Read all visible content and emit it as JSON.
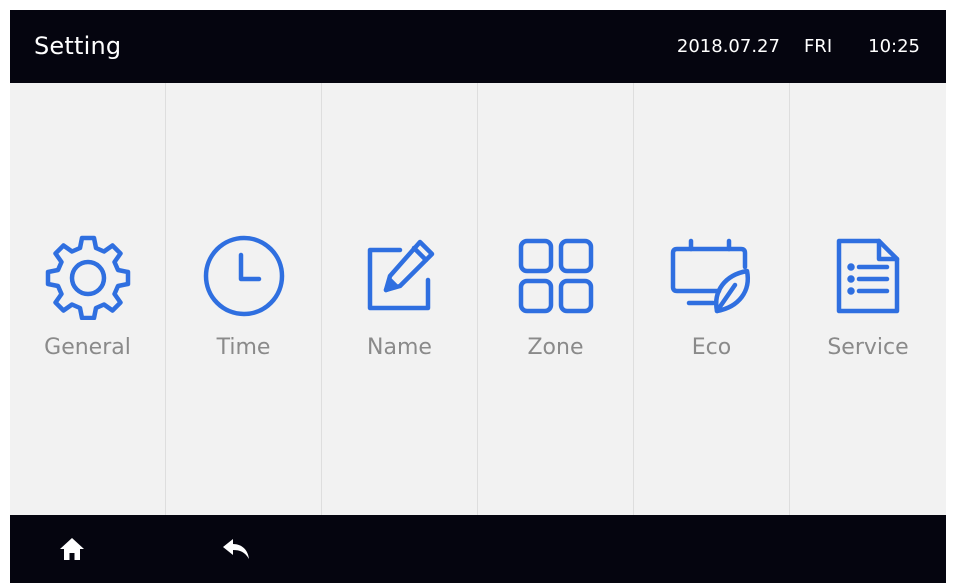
{
  "header": {
    "title": "Setting",
    "date": "2018.07.27",
    "day": "FRI",
    "time": "10:25"
  },
  "menu": {
    "items": [
      {
        "label": "General",
        "icon": "gear-icon"
      },
      {
        "label": "Time",
        "icon": "clock-icon"
      },
      {
        "label": "Name",
        "icon": "edit-icon"
      },
      {
        "label": "Zone",
        "icon": "grid-icon"
      },
      {
        "label": "Eco",
        "icon": "eco-leaf-icon"
      },
      {
        "label": "Service",
        "icon": "document-list-icon"
      }
    ]
  },
  "footer": {
    "home_icon": "home-icon",
    "back_icon": "back-arrow-icon"
  },
  "colors": {
    "bar_background": "#05050f",
    "tile_background": "#f2f2f2",
    "icon_accent": "#2f6fe0",
    "label_text": "#8a8a8a"
  }
}
